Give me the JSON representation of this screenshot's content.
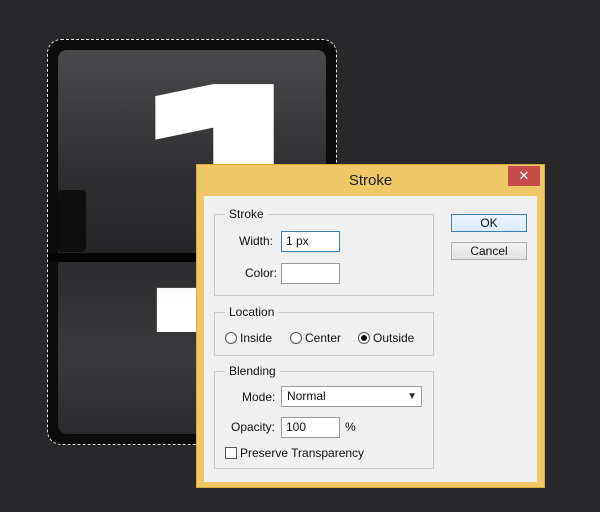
{
  "canvas": {
    "digit": "1"
  },
  "dialog": {
    "title": "Stroke",
    "close_label": "✕",
    "stroke": {
      "legend": "Stroke",
      "width_label": "Width:",
      "width_value": "1 px",
      "color_label": "Color:",
      "color_value": "#ffffff"
    },
    "location": {
      "legend": "Location",
      "options": [
        "Inside",
        "Center",
        "Outside"
      ],
      "selected": "Outside"
    },
    "blending": {
      "legend": "Blending",
      "mode_label": "Mode:",
      "mode_value": "Normal",
      "opacity_label": "Opacity:",
      "opacity_value": "100",
      "opacity_unit": "%",
      "preserve_label": "Preserve Transparency",
      "preserve_checked": false
    },
    "buttons": {
      "ok": "OK",
      "cancel": "Cancel"
    }
  }
}
